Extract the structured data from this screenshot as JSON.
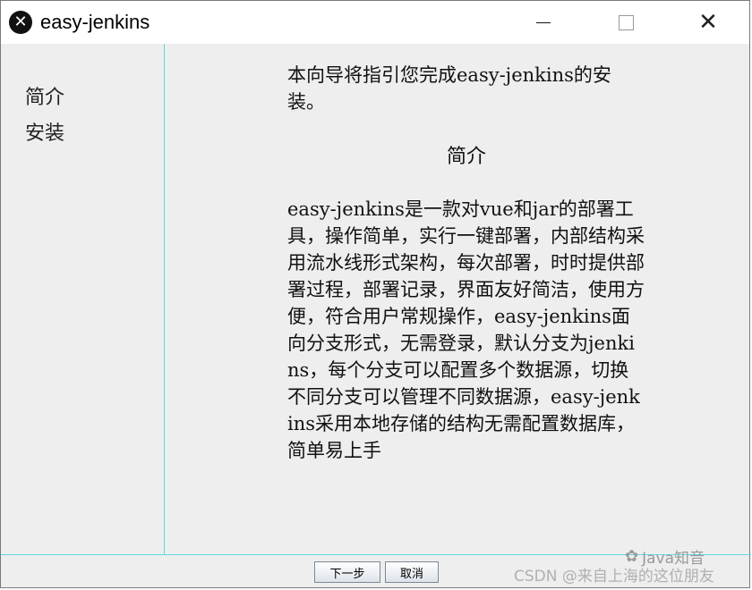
{
  "window": {
    "title": "easy-jenkins",
    "close_glyph": "✕",
    "app_icon": "x-circle-icon"
  },
  "sidebar": {
    "steps": [
      {
        "label": "简介"
      },
      {
        "label": "安装"
      }
    ]
  },
  "content": {
    "intro": "本向导将指引您完成easy-jenkins的安装。",
    "section_title": "简介",
    "body": "easy-jenkins是一款对vue和jar的部署工具，操作简单，实行一键部署，内部结构采用流水线形式架构，每次部署，时时提供部署过程，部署记录，界面友好简洁，使用方便，符合用户常规操作，easy-jenkins面向分支形式，无需登录，默认分支为jenkins，每个分支可以配置多个数据源，切换不同分支可以管理不同数据源，easy-jenkins采用本地存储的结构无需配置数据库，简单易上手"
  },
  "footer": {
    "next_label": "下一步",
    "cancel_label": "取消"
  },
  "watermarks": {
    "line1": "Java知音",
    "line2": "CSDN @来自上海的这位朋友"
  },
  "colors": {
    "divider": "#5fd8e0",
    "window_bg": "#eeeeee"
  }
}
